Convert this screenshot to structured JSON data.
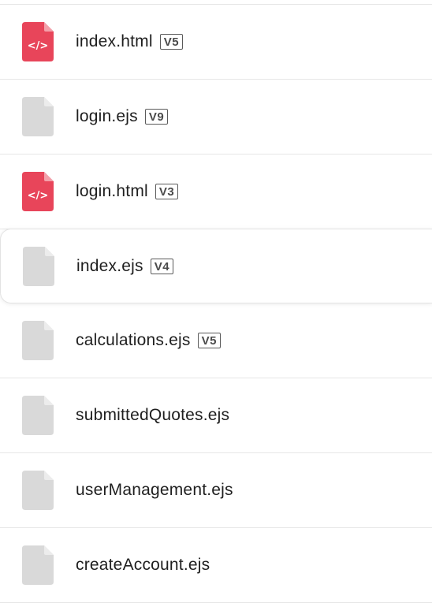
{
  "files": [
    {
      "name": "index.html",
      "version": "V5",
      "icon": "html-code-file-icon",
      "type": "html"
    },
    {
      "name": "login.ejs",
      "version": "V9",
      "icon": "generic-file-icon",
      "type": "ejs"
    },
    {
      "name": "login.html",
      "version": "V3",
      "icon": "html-code-file-icon",
      "type": "html"
    },
    {
      "name": "index.ejs",
      "version": "V4",
      "icon": "generic-file-icon",
      "type": "ejs",
      "hovered": true
    },
    {
      "name": "calculations.ejs",
      "version": "V5",
      "icon": "generic-file-icon",
      "type": "ejs"
    },
    {
      "name": "submittedQuotes.ejs",
      "version": "",
      "icon": "generic-file-icon",
      "type": "ejs"
    },
    {
      "name": "userManagement.ejs",
      "version": "",
      "icon": "generic-file-icon",
      "type": "ejs"
    },
    {
      "name": "createAccount.ejs",
      "version": "",
      "icon": "generic-file-icon",
      "type": "ejs"
    }
  ],
  "colors": {
    "html_icon": "#e8455a",
    "html_icon_fold": "#f3a0aa",
    "generic_icon": "#d9d9d9",
    "generic_icon_fold": "#ececec"
  }
}
